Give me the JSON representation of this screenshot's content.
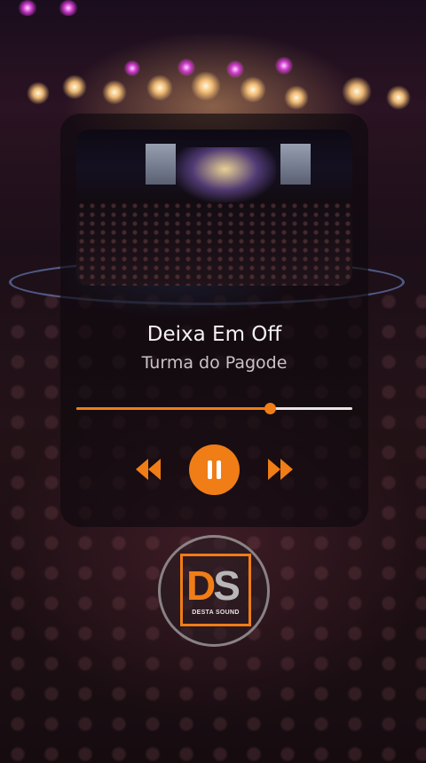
{
  "player": {
    "song_title": "Deixa Em Off",
    "artist": "Turma do Pagode",
    "progress_fraction": 0.7,
    "controls": {
      "rewind_icon": "rewind-icon",
      "pause_icon": "pause-icon",
      "forward_icon": "fast-forward-icon"
    }
  },
  "logo": {
    "mark_d": "D",
    "mark_s": "S",
    "brand": "DESTA SOUND"
  },
  "colors": {
    "accent": "#f07d16",
    "progress_track": "#e8e4e6",
    "title_text": "#f4f1f2",
    "artist_text": "#c9c3c5"
  }
}
